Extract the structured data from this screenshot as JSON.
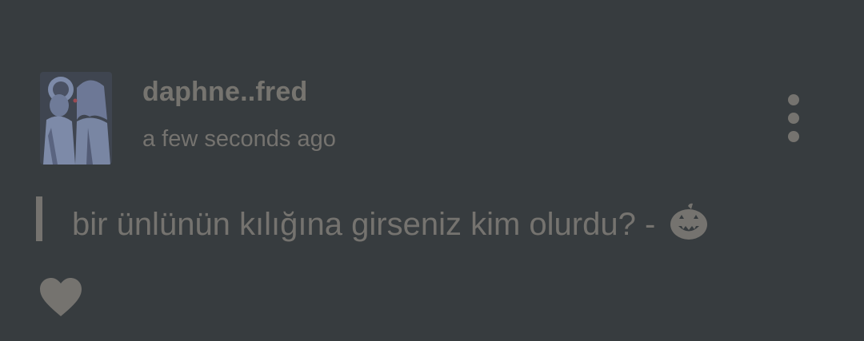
{
  "post": {
    "username": "daphne..fred",
    "timestamp": "a few seconds ago",
    "message": "bir ünlünün kılığına girseniz kim olurdu? -",
    "message_emoji": "jack-o-lantern-icon"
  },
  "icons": {
    "more": "vertical-ellipsis-icon",
    "like": "heart-icon"
  },
  "colors": {
    "background": "#373c3f",
    "text": "#75736f",
    "avatar_tint": "#7d8aa8"
  }
}
